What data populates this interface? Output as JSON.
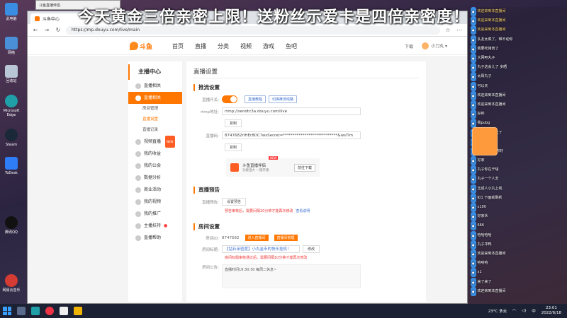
{
  "banner": "今天黄金三倍亲密上限！送粉丝示爱卡是四倍亲密度！",
  "mini_window_title": "斗鱼直播伴侣",
  "desktop_icons": [
    "此电脑",
    "网络",
    "回收站",
    "Microsoft Edge",
    "Steam",
    "ToDesk",
    "腾讯QQ",
    "网易云音乐"
  ],
  "browser": {
    "tab_title": "斗鱼中心",
    "url": "https://mp.douyu.com/live/main"
  },
  "header": {
    "logo_text": "斗鱼",
    "nav": [
      "首页",
      "直播",
      "分类",
      "视频",
      "游戏",
      "鱼吧"
    ],
    "download": "下载",
    "username": "小刀丸"
  },
  "sidebar": {
    "title": "主播中心",
    "items": [
      {
        "label": "直播相关",
        "active": false
      },
      {
        "label": "直播相关",
        "active": true
      }
    ],
    "subs": [
      "房间管理",
      "直播设置",
      "直播记录"
    ],
    "items2": [
      "视频直播",
      "我的收益",
      "我的公会",
      "数据分析",
      "商业活动",
      "我的视频",
      "我的推广",
      "主播扶持",
      "直播帮助"
    ],
    "badge": "NEW"
  },
  "main": {
    "page_title": "直播设置",
    "push": {
      "title": "推流设置",
      "switch_label": "直播开关:",
      "btn_tutorial": "直播教程",
      "btn_switch_line": "切换推流线路",
      "rtmp_label": "rtmp地址:",
      "rtmp_value": "rtmp://sendtc3a.douyu.com/live",
      "copy1": "复制",
      "code_label": "直播码:",
      "code_value": "8747682rIHEr8DC?wsSecret=****************************&wsTim",
      "copy2": "复制",
      "promo_title": "斗鱼直播伴侣",
      "promo_sub": "功能强大 一键开播",
      "promo_new": "NEW",
      "promo_download": "前往下载"
    },
    "preview": {
      "title": "直播预告",
      "label": "直播预告:",
      "btn": "设置预告",
      "warn": "预告审核后，需要间隔10分钟才能再次修改",
      "link": "查看说明"
    },
    "room": {
      "title": "房间设置",
      "id_label": "房间ID:",
      "id_value": "8747682",
      "btn_enter": "进入直播间",
      "btn_manage": "直播间管理",
      "title_label": "房间标题:",
      "title_value": "【钻石亲密度】小丸金币的快乐挂机！",
      "modify": "修改",
      "title_warn": "房间标题审核通过后，需要间隔10分钟才能再次修改",
      "notice_label": "房间公告:",
      "notice_value": "直播时间19:30:30 每周二休息~"
    }
  },
  "chat": [
    {
      "name": "欢迎来到本直播间",
      "text": ""
    },
    {
      "name": "欢迎来到本直播间",
      "text": ""
    },
    {
      "name": "欢迎来到本直播间",
      "text": ""
    },
    {
      "name": "",
      "text": "队友太菜了，带不动你"
    },
    {
      "name": "",
      "text": "我要吃烤肉了"
    },
    {
      "name": "",
      "text": "大网吧丸子"
    },
    {
      "name": "",
      "text": "丸子这会儿了 多晒"
    },
    {
      "name": "",
      "text": "太阳丸子"
    },
    {
      "name": "",
      "text": "可以天"
    },
    {
      "name": "",
      "text": "欢迎来到本直播间"
    },
    {
      "name": "",
      "text": "欢迎来到本直播间"
    },
    {
      "name": "",
      "text": "好帅"
    },
    {
      "name": "",
      "text": "我pubg"
    },
    {
      "name": "",
      "text": "丸子又要回去了"
    },
    {
      "name": "",
      "text": "小皮丸"
    },
    {
      "name": "",
      "text": "这对你来了 你好"
    },
    {
      "name": "",
      "text": "好家"
    },
    {
      "name": "",
      "text": "丸子你在干啥"
    },
    {
      "name": "",
      "text": "丸子一个人去"
    },
    {
      "name": "",
      "text": "玉成人小丸上线"
    },
    {
      "name": "",
      "text": "扣1 下面就刷新"
    },
    {
      "name": "",
      "text": "x100"
    },
    {
      "name": "",
      "text": "好家伙"
    },
    {
      "name": "",
      "text": "666"
    },
    {
      "name": "",
      "text": "哈哈哈哈"
    },
    {
      "name": "",
      "text": "丸子冲鸭"
    },
    {
      "name": "",
      "text": "欢迎来到本直播间"
    },
    {
      "name": "",
      "text": "哈哈哈"
    },
    {
      "name": "",
      "text": "x1"
    },
    {
      "name": "",
      "text": "来了来了"
    },
    {
      "name": "",
      "text": "欢迎来到本直播间"
    }
  ],
  "taskbar": {
    "temp": "23°C 多云",
    "time": "23:01",
    "date": "2022/6/18",
    "lang": "中"
  },
  "colors": {
    "accent": "#ff7700",
    "link": "#3a6fd0",
    "warn": "#ee3333"
  }
}
